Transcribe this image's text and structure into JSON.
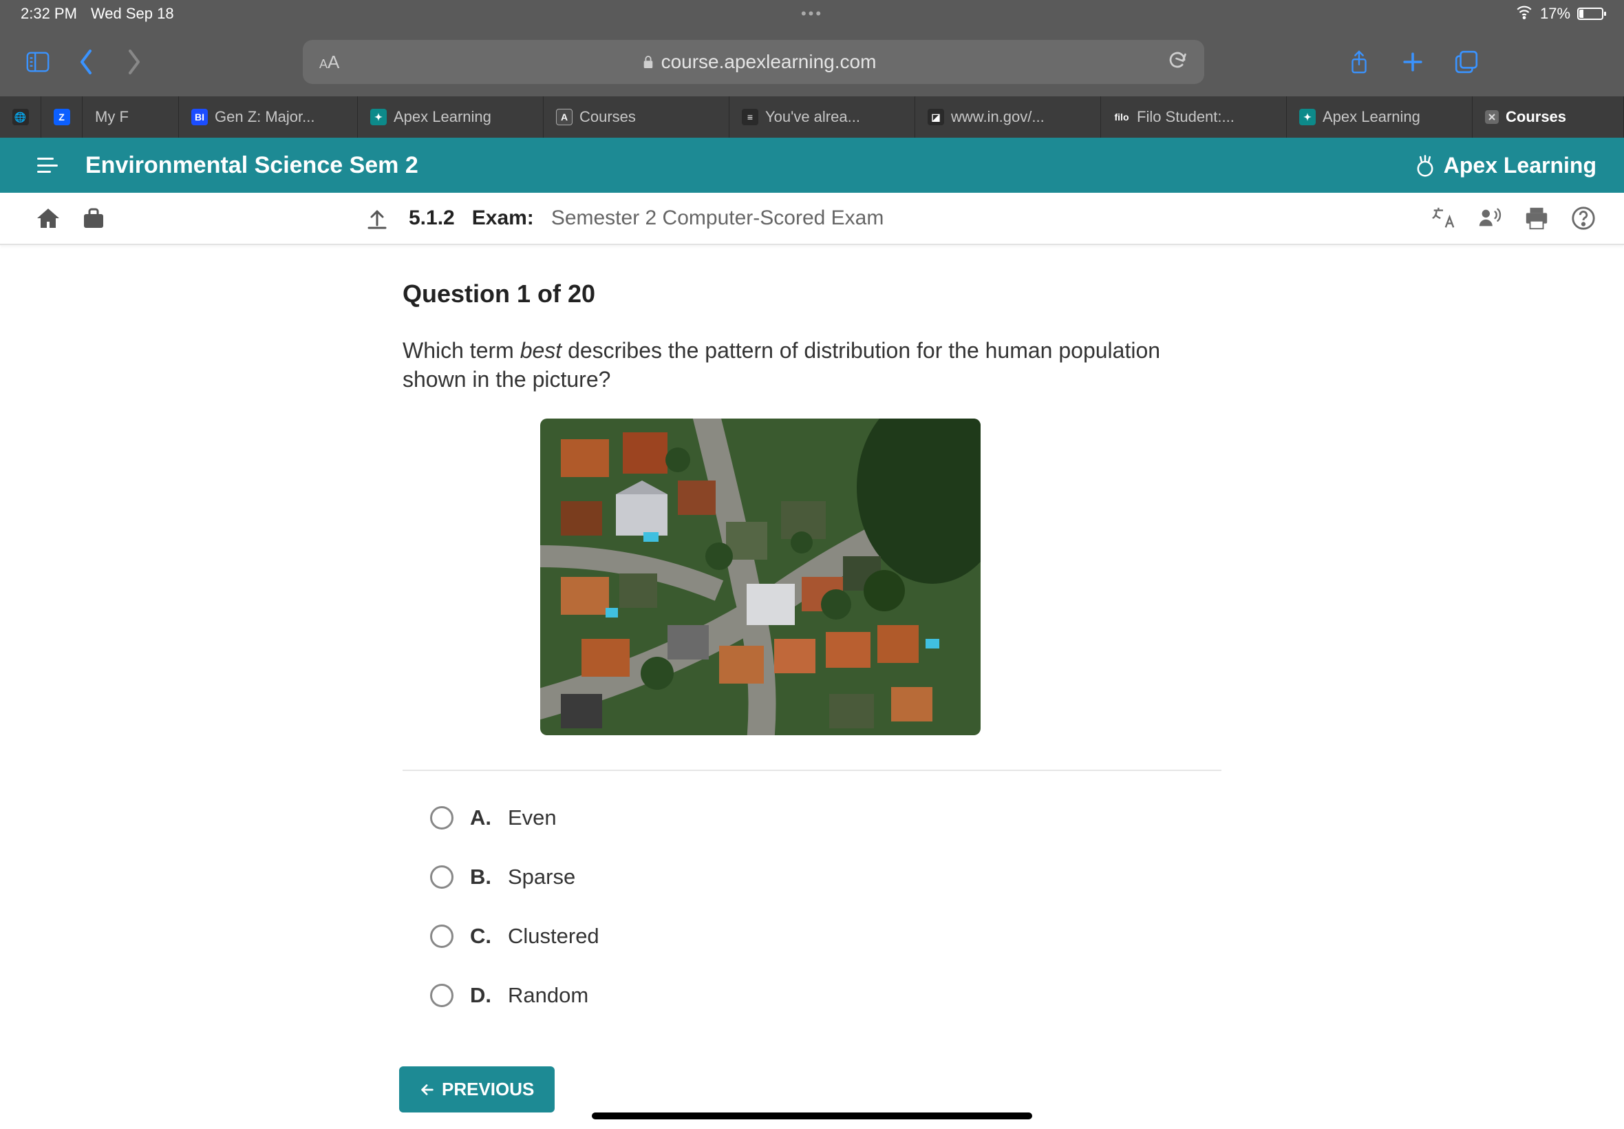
{
  "status": {
    "time": "2:32 PM",
    "date": "Wed Sep 18",
    "battery_pct": "17%"
  },
  "safari": {
    "aa": "AA",
    "url_host": "course.apexlearning.com"
  },
  "tabs": [
    {
      "label": "My F"
    },
    {
      "label": "Gen Z: Major..."
    },
    {
      "label": "Apex Learning"
    },
    {
      "label": "Courses"
    },
    {
      "label": "You've alrea..."
    },
    {
      "label": "www.in.gov/..."
    },
    {
      "label": "Filo Student:..."
    },
    {
      "label": "Apex Learning"
    },
    {
      "label": "Courses"
    }
  ],
  "app": {
    "course_title": "Environmental Science Sem 2",
    "brand": "Apex Learning"
  },
  "toolbar": {
    "exam_code": "5.1.2",
    "exam_word": "Exam:",
    "exam_title": "Semester 2 Computer-Scored Exam"
  },
  "question": {
    "heading": "Question 1 of 20",
    "prompt_pre": "Which term ",
    "prompt_ital": "best",
    "prompt_post": " describes the pattern of distribution for the human population shown in the picture?",
    "options": [
      {
        "letter": "A.",
        "text": "Even"
      },
      {
        "letter": "B.",
        "text": "Sparse"
      },
      {
        "letter": "C.",
        "text": "Clustered"
      },
      {
        "letter": "D.",
        "text": "Random"
      }
    ]
  },
  "buttons": {
    "previous": "PREVIOUS"
  }
}
